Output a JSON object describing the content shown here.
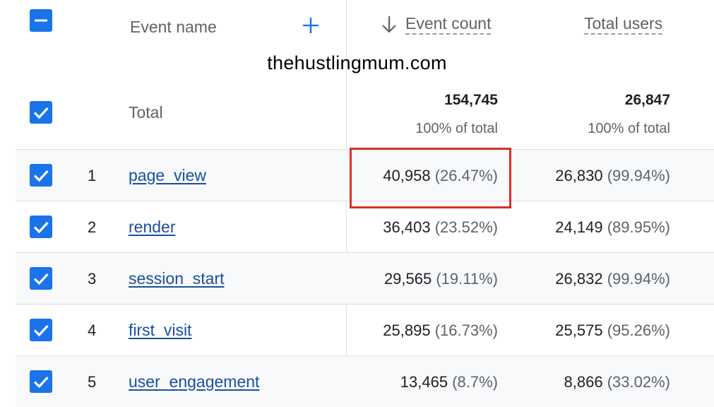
{
  "header": {
    "event_name_label": "Event name",
    "event_count_label": "Event count",
    "total_users_label": "Total users",
    "sort_icon": "arrow-down-icon",
    "add_icon": "plus-icon"
  },
  "watermark": "thehustlingmum.com",
  "totals": {
    "label": "Total",
    "event_count": "154,745",
    "event_count_sub": "100% of total",
    "total_users": "26,847",
    "total_users_sub": "100% of total"
  },
  "rows": [
    {
      "rank": "1",
      "name": "page_view",
      "event_count": "40,958",
      "event_pct": "(26.47%)",
      "users": "26,830",
      "users_pct": "(99.94%)"
    },
    {
      "rank": "2",
      "name": "render",
      "event_count": "36,403",
      "event_pct": "(23.52%)",
      "users": "24,149",
      "users_pct": "(89.95%)"
    },
    {
      "rank": "3",
      "name": "session_start",
      "event_count": "29,565",
      "event_pct": "(19.11%)",
      "users": "26,832",
      "users_pct": "(99.94%)"
    },
    {
      "rank": "4",
      "name": "first_visit",
      "event_count": "25,895",
      "event_pct": "(16.73%)",
      "users": "25,575",
      "users_pct": "(95.26%)"
    },
    {
      "rank": "5",
      "name": "user_engagement",
      "event_count": "13,465",
      "event_pct": "(8.7%)",
      "users": "8,866",
      "users_pct": "(33.02%)"
    }
  ],
  "colors": {
    "accent": "#1a73e8",
    "link": "#1a4fa0",
    "highlight": "#d93025"
  }
}
